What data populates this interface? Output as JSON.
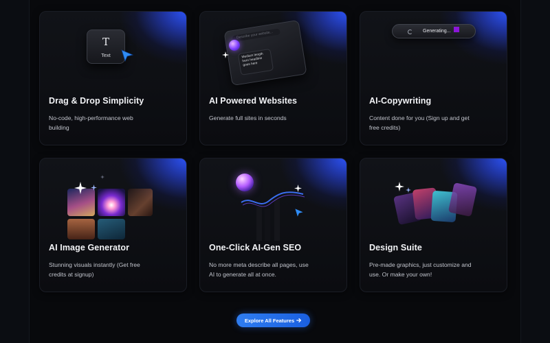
{
  "features": [
    {
      "title": "Drag & Drop Simplicity",
      "desc": "No-code, high-performance web building",
      "illustration": "text-tile-with-cursor",
      "tile_label": "Text",
      "tile_glyph": "T"
    },
    {
      "title": "AI Powered Websites",
      "desc": "Generate full sites in seconds",
      "illustration": "ai-chat-window",
      "window_placeholder": "Describe your website...",
      "window_note": "Medium length hero headline goes here"
    },
    {
      "title": "AI-Copywriting",
      "desc": "Content done for you (Sign up and get free credits)",
      "illustration": "generating-pill",
      "pill_text": "Generating..."
    },
    {
      "title": "AI Image Generator",
      "desc": "Stunning visuals instantly (Get free credits at signup)",
      "illustration": "image-grid-with-sparkles"
    },
    {
      "title": "One-Click AI-Gen SEO",
      "desc": "No more meta describe all pages, use AI to generate all at once.",
      "illustration": "orb-wave-cursor"
    },
    {
      "title": "Design Suite",
      "desc": "Pre-made graphics, just customize and use. Or make your own!",
      "illustration": "card-fan-with-sparkles"
    }
  ],
  "cta": {
    "label": "Explore All Features",
    "icon": "arrow-right-icon"
  },
  "colors": {
    "accent": "#2f7df0",
    "card_glow": "#2d55ff",
    "background": "#08090c",
    "generating_square": "#8b16d8"
  }
}
